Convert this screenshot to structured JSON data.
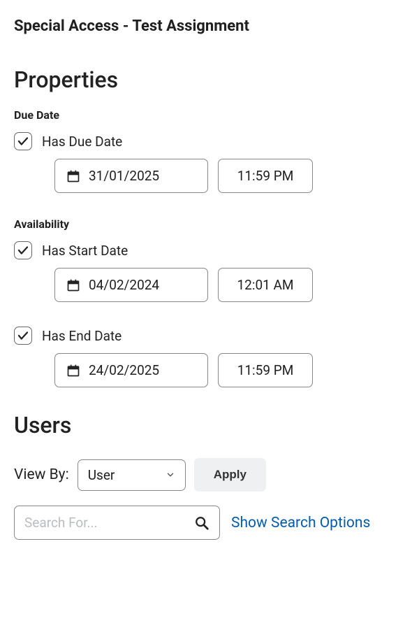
{
  "page_title": "Special Access - Test Assignment",
  "properties": {
    "heading": "Properties",
    "due_date": {
      "label": "Due Date",
      "checkbox_label": "Has Due Date",
      "checked": true,
      "date": "31/01/2025",
      "time": "11:59 PM"
    },
    "availability": {
      "label": "Availability",
      "start": {
        "checkbox_label": "Has Start Date",
        "checked": true,
        "date": "04/02/2024",
        "time": "12:01 AM"
      },
      "end": {
        "checkbox_label": "Has End Date",
        "checked": true,
        "date": "24/02/2025",
        "time": "11:59 PM"
      }
    }
  },
  "users": {
    "heading": "Users",
    "viewby_label": "View By:",
    "viewby_value": "User",
    "apply_label": "Apply",
    "search_placeholder": "Search For...",
    "show_options_label": "Show Search Options"
  }
}
